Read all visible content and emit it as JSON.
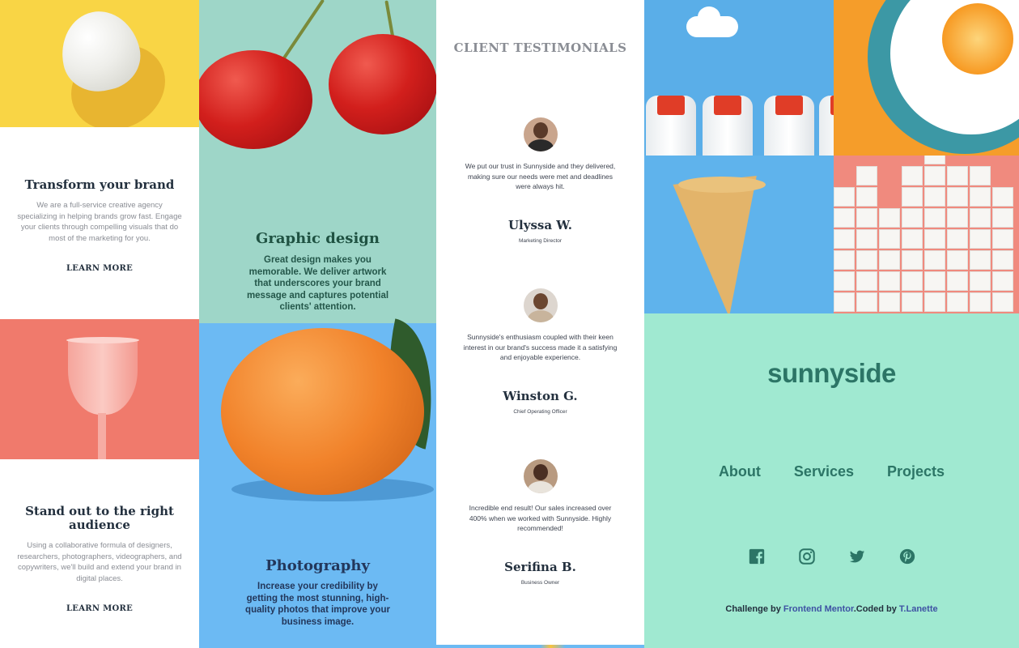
{
  "features": {
    "brand": {
      "title": "Transform your brand",
      "body": "We are a full-service creative agency specializing in helping brands grow fast. Engage your clients through compelling visuals that do most of the marketing for you.",
      "cta": "LEARN MORE"
    },
    "audience": {
      "title": "Stand out to the right audience",
      "body": "Using a collaborative formula of designers, researchers, photographers, videographers, and copywriters, we'll build and extend your brand in digital places.",
      "cta": "LEARN MORE"
    },
    "graphic_design": {
      "title": "Graphic design",
      "body": "Great design makes you memorable. We deliver artwork that underscores your brand message and captures potential clients' attention."
    },
    "photography": {
      "title": "Photography",
      "body": "Increase your credibility by getting the most stunning, high-quality photos that improve your business image."
    }
  },
  "testimonials": {
    "heading": "CLIENT TESTIMONIALS",
    "items": [
      {
        "quote": "We put our trust in Sunnyside and they delivered, making sure our needs were met and deadlines were always hit.",
        "name": "Ulyssa W.",
        "role": "Marketing Director"
      },
      {
        "quote": "Sunnyside's enthusiasm coupled with their keen interest in our brand's success made it a satisfying and enjoyable experience.",
        "name": "Winston G.",
        "role": "Chief Operating Officer"
      },
      {
        "quote": "Incredible end result! Our sales increased over 400% when we worked with Sunnyside. Highly recommended!",
        "name": "Serifina B.",
        "role": "Business Owner"
      }
    ]
  },
  "footer": {
    "logo": "sunnyside",
    "nav": [
      "About",
      "Services",
      "Projects"
    ],
    "social_icons": [
      "facebook-icon",
      "instagram-icon",
      "twitter-icon",
      "pinterest-icon"
    ],
    "attribution": {
      "prefix": "Challenge by",
      "challenge_link": "Frontend Mentor",
      "middle": ".Coded by",
      "author_link": "T.Lanette"
    }
  },
  "colors": {
    "footer_bg": "#a0e9d1",
    "footer_text": "#2c7566",
    "graphic_design_bg": "#9ed6c8",
    "photography_bg": "#6cbaf3",
    "egg_bg": "#f9d545",
    "glass_bg": "#f07a6c"
  }
}
